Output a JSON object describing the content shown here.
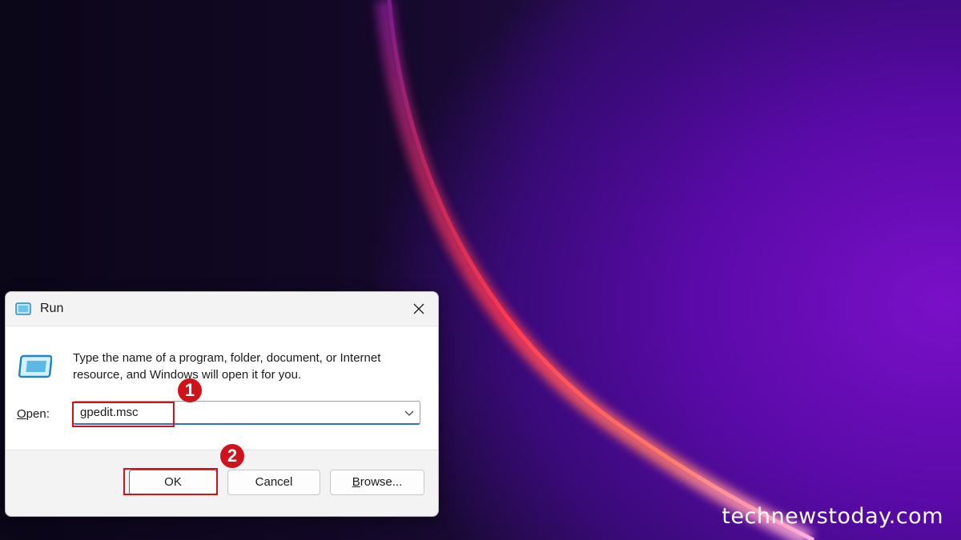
{
  "dialog": {
    "title": "Run",
    "description": "Type the name of a program, folder, document, or Internet resource, and Windows will open it for you.",
    "open_label_accel": "O",
    "open_label_rest": "pen:",
    "open_value": "gpedit.msc",
    "buttons": {
      "ok": "OK",
      "cancel": "Cancel",
      "browse_accel": "B",
      "browse_rest": "rowse..."
    }
  },
  "annotations": {
    "step1": "1",
    "step2": "2",
    "highlight_color": "#d0121b"
  },
  "watermark": "technewstoday.com",
  "icons": {
    "app": "run-app-icon",
    "close": "close-icon",
    "dropdown": "chevron-down-icon"
  },
  "colors": {
    "accent": "#2b6fd1",
    "dialog_bg": "#f3f3f3"
  }
}
